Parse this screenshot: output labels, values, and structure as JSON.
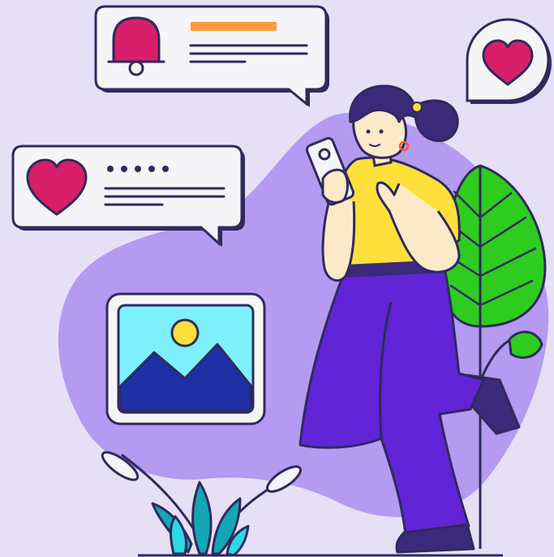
{
  "illustration": {
    "subject": "woman-using-smartphone",
    "icons": [
      "bell-icon",
      "heart-icon",
      "image-icon",
      "smartphone-icon"
    ]
  },
  "colors": {
    "background": "#e6e0f7",
    "blob": "#b49af0",
    "outline": "#2f2a5e",
    "card": "#f5f5f8",
    "accent_orange": "#ff9a3d",
    "heart": "#d81f6a",
    "shirt": "#ffe03a",
    "pants": "#6124d6",
    "skin": "#fbe9c8",
    "hair": "#3b2a7a",
    "leaf_green": "#2dcc1f",
    "sky": "#7ef0fb",
    "mountain": "#1e2fa3",
    "sun": "#ffe03a",
    "plant_teal": "#12a7b4"
  }
}
